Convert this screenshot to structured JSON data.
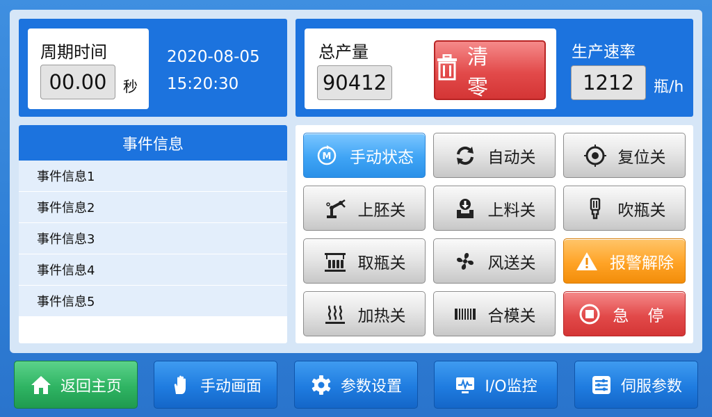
{
  "cycle": {
    "label": "周期时间",
    "value": "00.00",
    "unit": "秒"
  },
  "datetime": {
    "date": "2020-08-05",
    "time": "15:20:30"
  },
  "production": {
    "label": "总产量",
    "value": "90412",
    "clear_label": "清 零"
  },
  "rate": {
    "label": "生产速率",
    "value": "1212",
    "unit": "瓶/h"
  },
  "events": {
    "title": "事件信息",
    "items": [
      "事件信息1",
      "事件信息2",
      "事件信息3",
      "事件信息4",
      "事件信息5"
    ]
  },
  "buttons": [
    {
      "label": "手动状态",
      "icon": "manual-m-icon",
      "style": "blue"
    },
    {
      "label": "自动关",
      "icon": "cycle-arrows-icon",
      "style": "gray"
    },
    {
      "label": "复位关",
      "icon": "target-reset-icon",
      "style": "gray"
    },
    {
      "label": "上胚关",
      "icon": "robot-arm-icon",
      "style": "gray"
    },
    {
      "label": "上料关",
      "icon": "feed-download-icon",
      "style": "gray"
    },
    {
      "label": "吹瓶关",
      "icon": "bottle-icon",
      "style": "gray"
    },
    {
      "label": "取瓶关",
      "icon": "bottle-rack-icon",
      "style": "gray"
    },
    {
      "label": "风送关",
      "icon": "fan-icon",
      "style": "gray"
    },
    {
      "label": "报警解除",
      "icon": "warning-icon",
      "style": "orange"
    },
    {
      "label": "加热关",
      "icon": "heat-icon",
      "style": "gray"
    },
    {
      "label": "合模关",
      "icon": "mold-icon",
      "style": "gray"
    },
    {
      "label": "急 停",
      "icon": "stop-icon",
      "style": "red"
    }
  ],
  "nav": [
    {
      "label": "返回主页",
      "icon": "home-icon"
    },
    {
      "label": "手动画面",
      "icon": "hand-icon"
    },
    {
      "label": "参数设置",
      "icon": "gear-icon"
    },
    {
      "label": "I/O监控",
      "icon": "monitor-icon"
    },
    {
      "label": "伺服参数",
      "icon": "sliders-icon"
    }
  ],
  "colors": {
    "accent_blue": "#1c73de",
    "alarm_orange": "#ffa326",
    "stop_red": "#e24a4a",
    "home_green": "#2fb463"
  }
}
